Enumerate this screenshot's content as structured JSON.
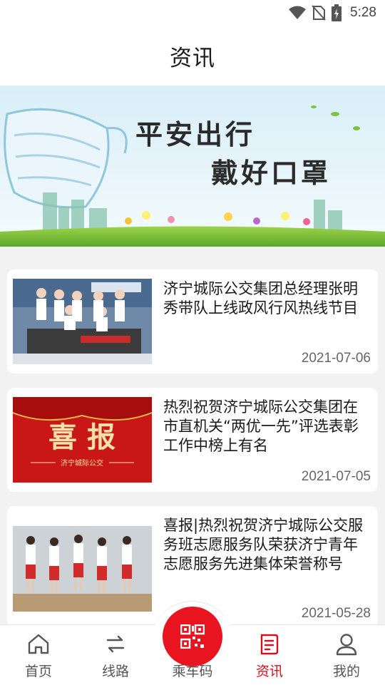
{
  "status_bar": {
    "time": "5:28"
  },
  "header": {
    "title": "资讯"
  },
  "banner": {
    "line1": "平安出行",
    "line2": "戴好口罩"
  },
  "news": [
    {
      "title": "济宁城际公交集团总经理张明秀带队上线政风行风热线节目",
      "date": "2021-07-06",
      "thumb_caption": ""
    },
    {
      "title": "热烈祝贺济宁城际公交集团在市直机关“两优一先”评选表彰工作中榜上有名",
      "date": "2021-07-05",
      "thumb_main": "喜 报",
      "thumb_sub": "济宁城际公交"
    },
    {
      "title": "喜报|热烈祝贺济宁城际公交服务班志愿服务队荣获济宁青年志愿服务先进集体荣誉称号",
      "date": "2021-05-28"
    }
  ],
  "tabs": [
    {
      "label": "首页",
      "icon": "home-icon"
    },
    {
      "label": "线路",
      "icon": "route-icon"
    },
    {
      "label": "乘车码",
      "icon": "qr-code-icon"
    },
    {
      "label": "资讯",
      "icon": "news-icon",
      "active": true
    },
    {
      "label": "我的",
      "icon": "profile-icon"
    }
  ],
  "colors": {
    "accent": "#d4121e",
    "qr_button": "#e8141f"
  }
}
